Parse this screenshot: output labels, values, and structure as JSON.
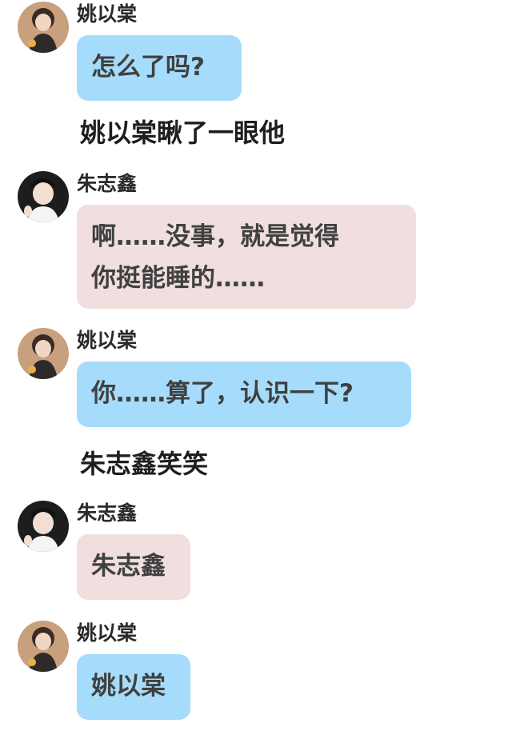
{
  "messages": [
    {
      "sender": "姚以棠",
      "text": "怎么了吗?",
      "side": "blue"
    },
    {
      "narration": "姚以棠瞅了一眼他"
    },
    {
      "sender": "朱志鑫",
      "text": "啊……没事，就是觉得\n你挺能睡的……",
      "side": "pink"
    },
    {
      "sender": "姚以棠",
      "text": "你……算了，认识一下?",
      "side": "blue"
    },
    {
      "narration": "朱志鑫笑笑"
    },
    {
      "sender": "朱志鑫",
      "text": "朱志鑫",
      "side": "pink"
    },
    {
      "sender": "姚以棠",
      "text": "姚以棠",
      "side": "blue"
    }
  ],
  "colors": {
    "blue_bubble": "#a6dcfb",
    "pink_bubble": "#f1dede"
  }
}
